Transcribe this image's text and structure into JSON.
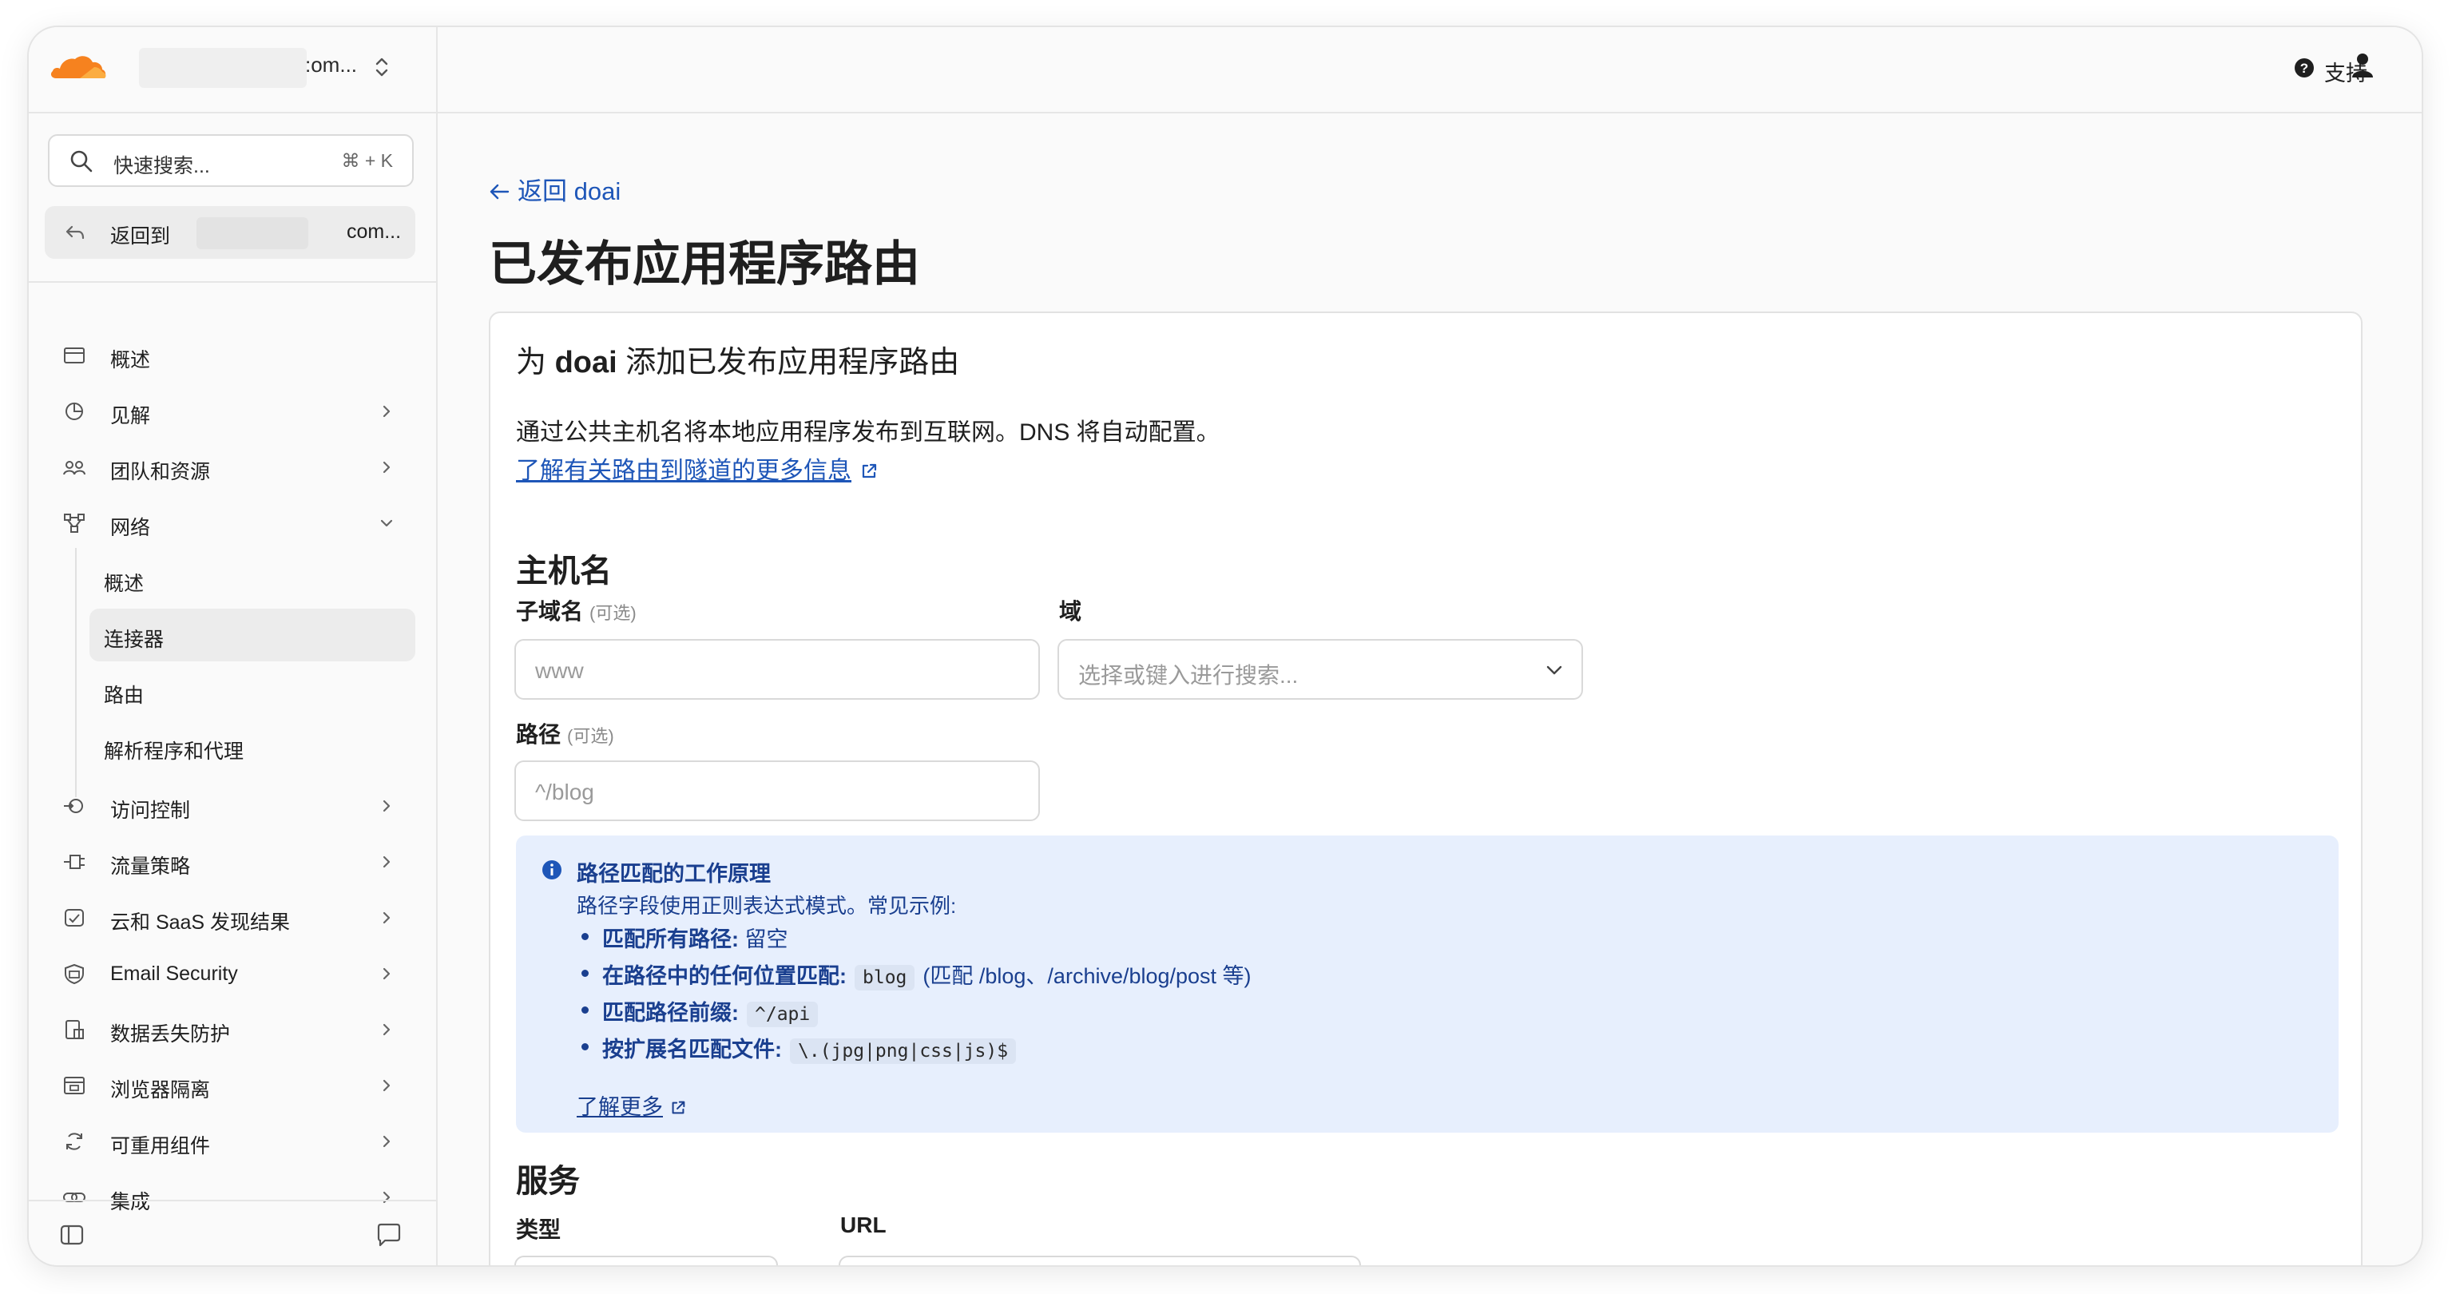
{
  "account": {
    "name_suffix": ":om..."
  },
  "search": {
    "placeholder": "快速搜索...",
    "shortcut": "⌘ + K"
  },
  "back_to": {
    "label": "返回到",
    "name_suffix": "com..."
  },
  "sidebar": {
    "items": [
      {
        "label": "概述",
        "icon": "overview-icon"
      },
      {
        "label": "见解",
        "icon": "insights-icon",
        "chevron": "right"
      },
      {
        "label": "团队和资源",
        "icon": "team-icon",
        "chevron": "right"
      },
      {
        "label": "网络",
        "icon": "network-icon",
        "chevron": "down"
      },
      {
        "label": "访问控制",
        "icon": "access-control-icon",
        "chevron": "right"
      },
      {
        "label": "流量策略",
        "icon": "traffic-policy-icon",
        "chevron": "right"
      },
      {
        "label": "云和 SaaS 发现结果",
        "icon": "cloud-saas-icon",
        "chevron": "right"
      },
      {
        "label": "Email Security",
        "icon": "email-security-icon",
        "chevron": "right"
      },
      {
        "label": "数据丢失防护",
        "icon": "dlp-icon",
        "chevron": "right"
      },
      {
        "label": "浏览器隔离",
        "icon": "browser-isolation-icon",
        "chevron": "right"
      },
      {
        "label": "可重用组件",
        "icon": "reusable-components-icon",
        "chevron": "right"
      },
      {
        "label": "集成",
        "icon": "integrations-icon",
        "chevron": "right"
      }
    ],
    "network_sub": [
      {
        "label": "概述"
      },
      {
        "label": "连接器",
        "active": true
      },
      {
        "label": "路由"
      },
      {
        "label": "解析程序和代理"
      }
    ]
  },
  "topbar": {
    "support_label": "支持"
  },
  "main": {
    "back_link": "返回 doai",
    "page_title": "已发布应用程序路由",
    "card": {
      "title_prefix": "为 ",
      "title_bold": "doai",
      "title_suffix": " 添加已发布应用程序路由",
      "description": "通过公共主机名将本地应用程序发布到互联网。DNS 将自动配置。",
      "learn_more": "了解有关路由到隧道的更多信息",
      "hostname_heading": "主机名",
      "subdomain_label": "子域名",
      "optional": "(可选)",
      "subdomain_placeholder": "www",
      "domain_label": "域",
      "domain_placeholder": "选择或键入进行搜索...",
      "path_label": "路径",
      "path_placeholder": "^/blog",
      "info": {
        "title": "路径匹配的工作原理",
        "description": "路径字段使用正则表达式模式。常见示例:",
        "items": [
          {
            "label": "匹配所有路径:",
            "value": "留空"
          },
          {
            "label": "在路径中的任何位置匹配:",
            "code": "blog",
            "note": "(匹配 /blog、/archive/blog/post 等)"
          },
          {
            "label": "匹配路径前缀:",
            "code": "^/api"
          },
          {
            "label": "按扩展名匹配文件:",
            "code": "\\.(jpg|png|css|js)$"
          }
        ],
        "learn_more": "了解更多"
      },
      "service_heading": "服务",
      "type_label": "类型",
      "url_label": "URL"
    }
  },
  "colors": {
    "accent": "#f6821f",
    "link": "#1e56b8",
    "info_bg": "#e7effd"
  }
}
